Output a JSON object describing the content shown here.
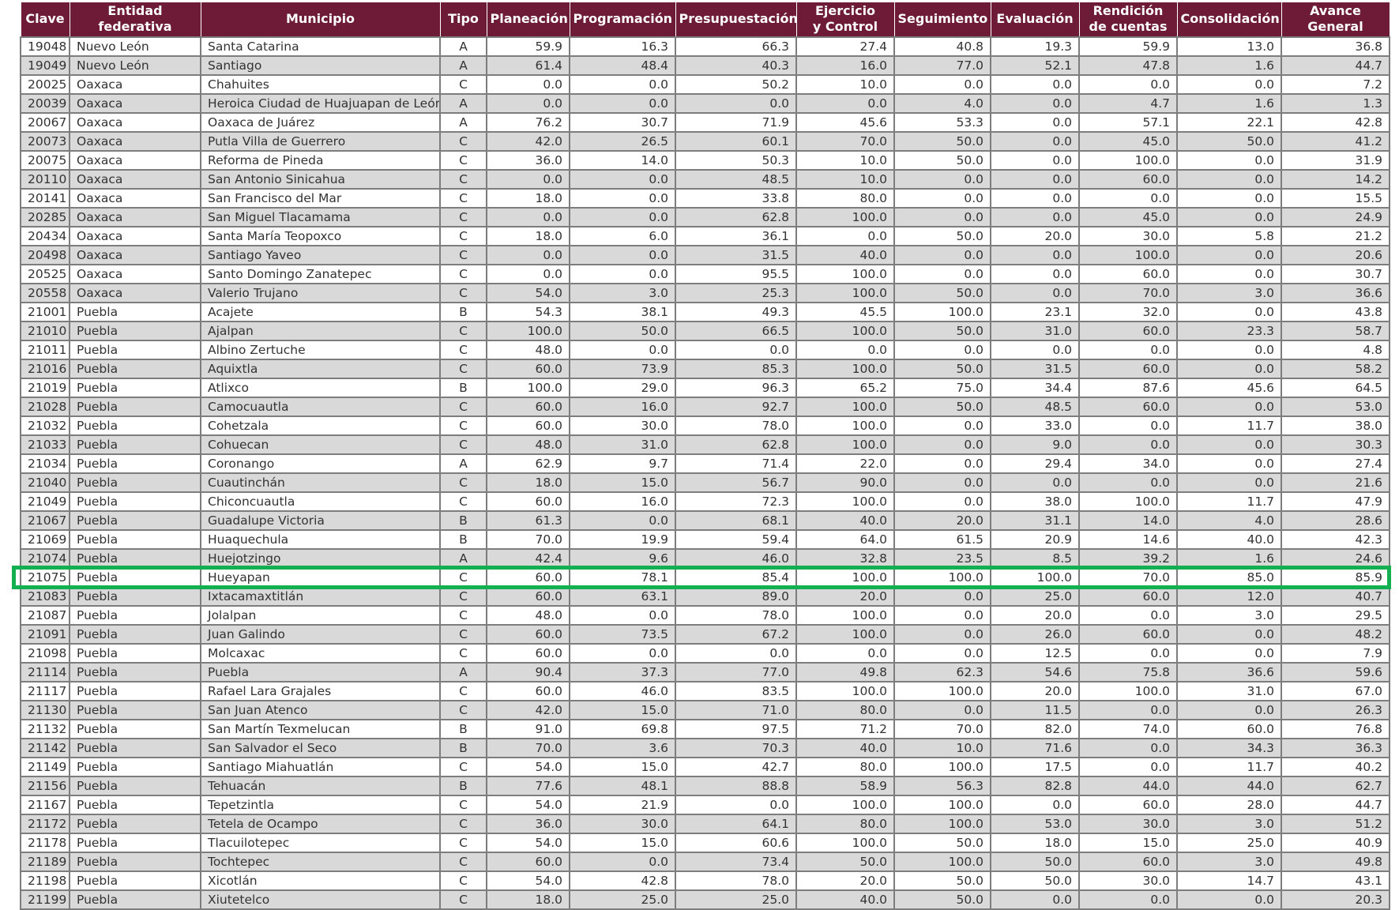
{
  "columns": [
    [
      "Clave"
    ],
    [
      "Entidad federativa"
    ],
    [
      "Municipio"
    ],
    [
      "Tipo"
    ],
    [
      "Planeación"
    ],
    [
      "Programación"
    ],
    [
      "Presupuestación"
    ],
    [
      "Ejercicio",
      "y Control"
    ],
    [
      "Seguimiento"
    ],
    [
      "Evaluación"
    ],
    [
      "Rendición",
      "de cuentas"
    ],
    [
      "Consolidación"
    ],
    [
      "Avance General"
    ]
  ],
  "rows": [
    [
      "19048",
      "Nuevo León",
      "Santa Catarina",
      "A",
      "59.9",
      "16.3",
      "66.3",
      "27.4",
      "40.8",
      "19.3",
      "59.9",
      "13.0",
      "36.8"
    ],
    [
      "19049",
      "Nuevo León",
      "Santiago",
      "A",
      "61.4",
      "48.4",
      "40.3",
      "16.0",
      "77.0",
      "52.1",
      "47.8",
      "1.6",
      "44.7"
    ],
    [
      "20025",
      "Oaxaca",
      "Chahuites",
      "C",
      "0.0",
      "0.0",
      "50.2",
      "10.0",
      "0.0",
      "0.0",
      "0.0",
      "0.0",
      "7.2"
    ],
    [
      "20039",
      "Oaxaca",
      "Heroica Ciudad de Huajuapan de León",
      "A",
      "0.0",
      "0.0",
      "0.0",
      "0.0",
      "4.0",
      "0.0",
      "4.7",
      "1.6",
      "1.3"
    ],
    [
      "20067",
      "Oaxaca",
      "Oaxaca de Juárez",
      "A",
      "76.2",
      "30.7",
      "71.9",
      "45.6",
      "53.3",
      "0.0",
      "57.1",
      "22.1",
      "42.8"
    ],
    [
      "20073",
      "Oaxaca",
      "Putla Villa de Guerrero",
      "C",
      "42.0",
      "26.5",
      "60.1",
      "70.0",
      "50.0",
      "0.0",
      "45.0",
      "50.0",
      "41.2"
    ],
    [
      "20075",
      "Oaxaca",
      "Reforma de Pineda",
      "C",
      "36.0",
      "14.0",
      "50.3",
      "10.0",
      "50.0",
      "0.0",
      "100.0",
      "0.0",
      "31.9"
    ],
    [
      "20110",
      "Oaxaca",
      "San Antonio Sinicahua",
      "C",
      "0.0",
      "0.0",
      "48.5",
      "10.0",
      "0.0",
      "0.0",
      "60.0",
      "0.0",
      "14.2"
    ],
    [
      "20141",
      "Oaxaca",
      "San Francisco del Mar",
      "C",
      "18.0",
      "0.0",
      "33.8",
      "80.0",
      "0.0",
      "0.0",
      "0.0",
      "0.0",
      "15.5"
    ],
    [
      "20285",
      "Oaxaca",
      "San Miguel Tlacamama",
      "C",
      "0.0",
      "0.0",
      "62.8",
      "100.0",
      "0.0",
      "0.0",
      "45.0",
      "0.0",
      "24.9"
    ],
    [
      "20434",
      "Oaxaca",
      "Santa María Teopoxco",
      "C",
      "18.0",
      "6.0",
      "36.1",
      "0.0",
      "50.0",
      "20.0",
      "30.0",
      "5.8",
      "21.2"
    ],
    [
      "20498",
      "Oaxaca",
      "Santiago Yaveo",
      "C",
      "0.0",
      "0.0",
      "31.5",
      "40.0",
      "0.0",
      "0.0",
      "100.0",
      "0.0",
      "20.6"
    ],
    [
      "20525",
      "Oaxaca",
      "Santo Domingo Zanatepec",
      "C",
      "0.0",
      "0.0",
      "95.5",
      "100.0",
      "0.0",
      "0.0",
      "60.0",
      "0.0",
      "30.7"
    ],
    [
      "20558",
      "Oaxaca",
      "Valerio Trujano",
      "C",
      "54.0",
      "3.0",
      "25.3",
      "100.0",
      "50.0",
      "0.0",
      "70.0",
      "3.0",
      "36.6"
    ],
    [
      "21001",
      "Puebla",
      "Acajete",
      "B",
      "54.3",
      "38.1",
      "49.3",
      "45.5",
      "100.0",
      "23.1",
      "32.0",
      "0.0",
      "43.8"
    ],
    [
      "21010",
      "Puebla",
      "Ajalpan",
      "C",
      "100.0",
      "50.0",
      "66.5",
      "100.0",
      "50.0",
      "31.0",
      "60.0",
      "23.3",
      "58.7"
    ],
    [
      "21011",
      "Puebla",
      "Albino Zertuche",
      "C",
      "48.0",
      "0.0",
      "0.0",
      "0.0",
      "0.0",
      "0.0",
      "0.0",
      "0.0",
      "4.8"
    ],
    [
      "21016",
      "Puebla",
      "Aquixtla",
      "C",
      "60.0",
      "73.9",
      "85.3",
      "100.0",
      "50.0",
      "31.5",
      "60.0",
      "0.0",
      "58.2"
    ],
    [
      "21019",
      "Puebla",
      "Atlixco",
      "B",
      "100.0",
      "29.0",
      "96.3",
      "65.2",
      "75.0",
      "34.4",
      "87.6",
      "45.6",
      "64.5"
    ],
    [
      "21028",
      "Puebla",
      "Camocuautla",
      "C",
      "60.0",
      "16.0",
      "92.7",
      "100.0",
      "50.0",
      "48.5",
      "60.0",
      "0.0",
      "53.0"
    ],
    [
      "21032",
      "Puebla",
      "Cohetzala",
      "C",
      "60.0",
      "30.0",
      "78.0",
      "100.0",
      "0.0",
      "33.0",
      "0.0",
      "11.7",
      "38.0"
    ],
    [
      "21033",
      "Puebla",
      "Cohuecan",
      "C",
      "48.0",
      "31.0",
      "62.8",
      "100.0",
      "0.0",
      "9.0",
      "0.0",
      "0.0",
      "30.3"
    ],
    [
      "21034",
      "Puebla",
      "Coronango",
      "A",
      "62.9",
      "9.7",
      "71.4",
      "22.0",
      "0.0",
      "29.4",
      "34.0",
      "0.0",
      "27.4"
    ],
    [
      "21040",
      "Puebla",
      "Cuautinchán",
      "C",
      "18.0",
      "15.0",
      "56.7",
      "90.0",
      "0.0",
      "0.0",
      "0.0",
      "0.0",
      "21.6"
    ],
    [
      "21049",
      "Puebla",
      "Chiconcuautla",
      "C",
      "60.0",
      "16.0",
      "72.3",
      "100.0",
      "0.0",
      "38.0",
      "100.0",
      "11.7",
      "47.9"
    ],
    [
      "21067",
      "Puebla",
      "Guadalupe Victoria",
      "B",
      "61.3",
      "0.0",
      "68.1",
      "40.0",
      "20.0",
      "31.1",
      "14.0",
      "4.0",
      "28.6"
    ],
    [
      "21069",
      "Puebla",
      "Huaquechula",
      "B",
      "70.0",
      "19.9",
      "59.4",
      "64.0",
      "61.5",
      "20.9",
      "14.6",
      "40.0",
      "42.3"
    ],
    [
      "21074",
      "Puebla",
      "Huejotzingo",
      "A",
      "42.4",
      "9.6",
      "46.0",
      "32.8",
      "23.5",
      "8.5",
      "39.2",
      "1.6",
      "24.6"
    ],
    [
      "21075",
      "Puebla",
      "Hueyapan",
      "C",
      "60.0",
      "78.1",
      "85.4",
      "100.0",
      "100.0",
      "100.0",
      "70.0",
      "85.0",
      "85.9"
    ],
    [
      "21083",
      "Puebla",
      "Ixtacamaxtitlán",
      "C",
      "60.0",
      "63.1",
      "89.0",
      "20.0",
      "0.0",
      "25.0",
      "60.0",
      "12.0",
      "40.7"
    ],
    [
      "21087",
      "Puebla",
      "Jolalpan",
      "C",
      "48.0",
      "0.0",
      "78.0",
      "100.0",
      "0.0",
      "20.0",
      "0.0",
      "3.0",
      "29.5"
    ],
    [
      "21091",
      "Puebla",
      "Juan Galindo",
      "C",
      "60.0",
      "73.5",
      "67.2",
      "100.0",
      "0.0",
      "26.0",
      "60.0",
      "0.0",
      "48.2"
    ],
    [
      "21098",
      "Puebla",
      "Molcaxac",
      "C",
      "60.0",
      "0.0",
      "0.0",
      "0.0",
      "0.0",
      "12.5",
      "0.0",
      "0.0",
      "7.9"
    ],
    [
      "21114",
      "Puebla",
      "Puebla",
      "A",
      "90.4",
      "37.3",
      "77.0",
      "49.8",
      "62.3",
      "54.6",
      "75.8",
      "36.6",
      "59.6"
    ],
    [
      "21117",
      "Puebla",
      "Rafael Lara Grajales",
      "C",
      "60.0",
      "46.0",
      "83.5",
      "100.0",
      "100.0",
      "20.0",
      "100.0",
      "31.0",
      "67.0"
    ],
    [
      "21130",
      "Puebla",
      "San Juan Atenco",
      "C",
      "42.0",
      "15.0",
      "71.0",
      "80.0",
      "0.0",
      "11.5",
      "0.0",
      "0.0",
      "26.3"
    ],
    [
      "21132",
      "Puebla",
      "San Martín Texmelucan",
      "B",
      "91.0",
      "69.8",
      "97.5",
      "71.2",
      "70.0",
      "82.0",
      "74.0",
      "60.0",
      "76.8"
    ],
    [
      "21142",
      "Puebla",
      "San Salvador el Seco",
      "B",
      "70.0",
      "3.6",
      "70.3",
      "40.0",
      "10.0",
      "71.6",
      "0.0",
      "34.3",
      "36.3"
    ],
    [
      "21149",
      "Puebla",
      "Santiago Miahuatlán",
      "C",
      "54.0",
      "15.0",
      "42.7",
      "80.0",
      "100.0",
      "17.5",
      "0.0",
      "11.7",
      "40.2"
    ],
    [
      "21156",
      "Puebla",
      "Tehuacán",
      "B",
      "77.6",
      "48.1",
      "88.8",
      "58.9",
      "56.3",
      "82.8",
      "44.0",
      "44.0",
      "62.7"
    ],
    [
      "21167",
      "Puebla",
      "Tepetzintla",
      "C",
      "54.0",
      "21.9",
      "0.0",
      "100.0",
      "100.0",
      "0.0",
      "60.0",
      "28.0",
      "44.7"
    ],
    [
      "21172",
      "Puebla",
      "Tetela de Ocampo",
      "C",
      "36.0",
      "30.0",
      "64.1",
      "80.0",
      "100.0",
      "53.0",
      "30.0",
      "3.0",
      "51.2"
    ],
    [
      "21178",
      "Puebla",
      "Tlacuilotepec",
      "C",
      "54.0",
      "15.0",
      "60.6",
      "100.0",
      "50.0",
      "18.0",
      "15.0",
      "25.0",
      "40.9"
    ],
    [
      "21189",
      "Puebla",
      "Tochtepec",
      "C",
      "60.0",
      "0.0",
      "73.4",
      "50.0",
      "100.0",
      "50.0",
      "60.0",
      "3.0",
      "49.8"
    ],
    [
      "21198",
      "Puebla",
      "Xicotlán",
      "C",
      "54.0",
      "42.8",
      "78.0",
      "20.0",
      "50.0",
      "50.0",
      "30.0",
      "14.7",
      "43.1"
    ],
    [
      "21199",
      "Puebla",
      "Xiutetelco",
      "C",
      "18.0",
      "25.0",
      "25.0",
      "40.0",
      "50.0",
      "0.0",
      "0.0",
      "0.0",
      "20.3"
    ]
  ],
  "highlighted_clave": "21075",
  "colors": {
    "header_bg": "#6d1b36",
    "header_text": "#ffffff",
    "row_alt_bg": "#d9d9d9",
    "grid": "#7d7d7d",
    "highlight": "#12b050"
  }
}
